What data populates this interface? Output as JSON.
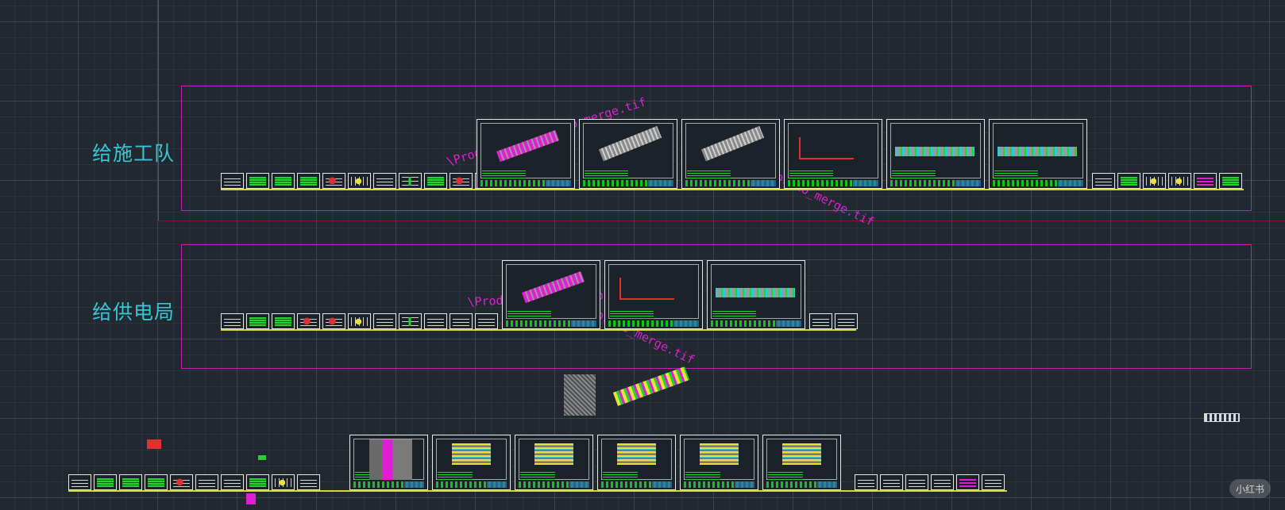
{
  "groups": [
    {
      "label": "给施工队"
    },
    {
      "label": "给供电局"
    }
  ],
  "image_refs": {
    "top_a": "\\Production_2_ortho_merge.tif",
    "top_b": "\\Production_2_ortho_merge.tif",
    "mid_a": "\\Production_2_ortho_merge.tif",
    "mid_b": "\\Production_2_ortho_merge.tif"
  },
  "watermark": "小红书",
  "colors": {
    "background": "#212830",
    "group_frame": "#c21fb5",
    "group_label": "#35c7d6",
    "image_label": "#e01fd4",
    "sheet_border": "#e8e8e8",
    "annotation_green": "#22d42c"
  }
}
